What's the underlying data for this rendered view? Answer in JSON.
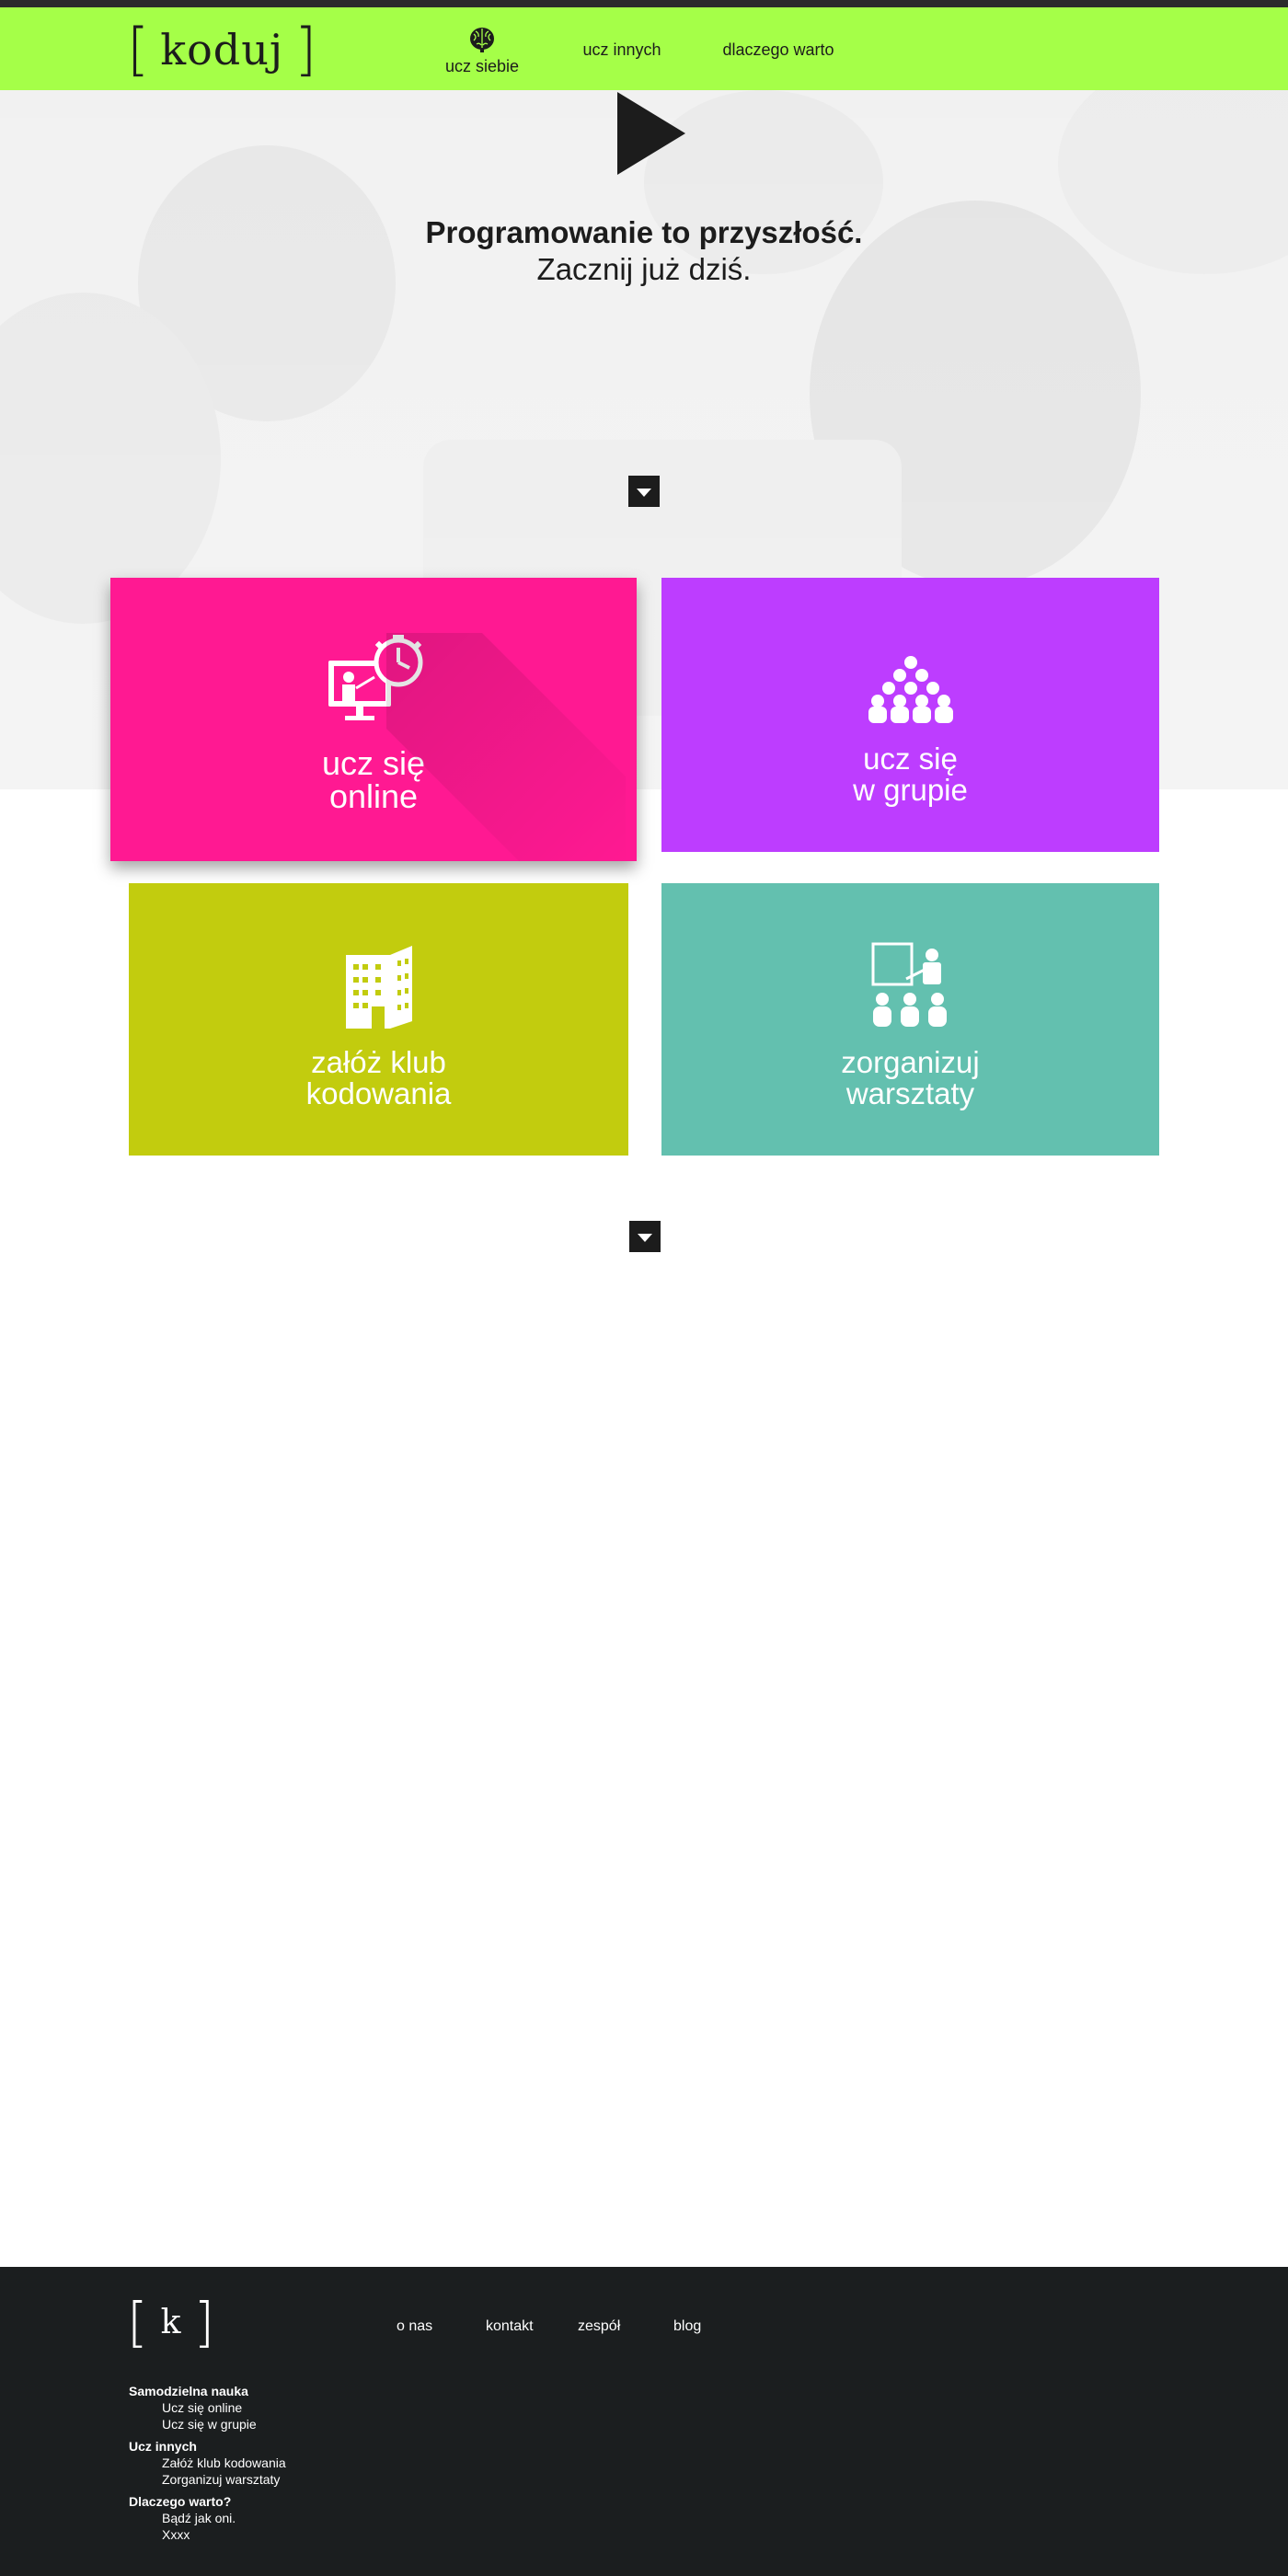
{
  "brand": {
    "logo_text": "koduj",
    "footer_logo_letter": "k",
    "accent": "#a5ff48",
    "dark": "#1b1e1f"
  },
  "nav": {
    "items": [
      {
        "label": "ucz siebie",
        "active": true,
        "icon": "brain-icon"
      },
      {
        "label": "ucz innych",
        "active": false
      },
      {
        "label": "dlaczego warto",
        "active": false
      }
    ]
  },
  "hero": {
    "headline_bold": "Programowanie to przyszłość.",
    "headline_normal": "Zacznij już dziś.",
    "play_icon": "play-icon"
  },
  "tiles": [
    {
      "line1": "ucz się",
      "line2": "online",
      "color": "#ff1992",
      "icon": "online-teacher-icon"
    },
    {
      "line1": "ucz się",
      "line2": "w grupie",
      "color": "#bd3dff",
      "icon": "group-icon"
    },
    {
      "line1": "załóż klub",
      "line2": "kodowania",
      "color": "#c2cc0e",
      "icon": "building-icon"
    },
    {
      "line1": "zorganizuj",
      "line2": "warsztaty",
      "color": "#63c0af",
      "icon": "workshop-icon"
    }
  ],
  "footer": {
    "nav": [
      "o nas",
      "kontakt",
      "zespół",
      "blog"
    ],
    "sitemap": [
      {
        "heading": "Samodzielna nauka",
        "links": [
          "Ucz się online",
          "Ucz się w grupie"
        ]
      },
      {
        "heading": "Ucz innych",
        "links": [
          "Załóż klub kodowania",
          "Zorganizuj warsztaty"
        ]
      },
      {
        "heading": "Dlaczego warto?",
        "links": [
          "Bądź jak oni.",
          "Xxxx"
        ]
      }
    ]
  }
}
